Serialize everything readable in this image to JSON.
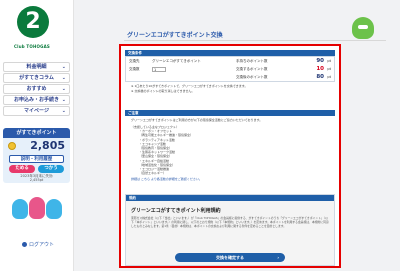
{
  "brand": {
    "number": "2",
    "name": "Club TOHOGAS"
  },
  "nav": {
    "items": [
      {
        "label": "料金明細"
      },
      {
        "label": "がすてきコラム"
      },
      {
        "label": "おすすめ"
      },
      {
        "label": "お申込み・お手続き"
      },
      {
        "label": "マイページ"
      }
    ]
  },
  "points": {
    "header": "がすてきポイント",
    "value": "2,805",
    "exchange_label": "説明・利用履歴",
    "save_label": "ためる",
    "use_label": "つかう",
    "expire_date": "2023年3月末に失効",
    "expire_points": "2,455pt"
  },
  "logout": {
    "label": "ログアウト"
  },
  "main": {
    "title": "グリーンエコがすてきポイント交換",
    "form_header": "交換条件",
    "row1": {
      "label": "交換先",
      "value": "グリーンエコがすてきポイント",
      "right_label": "手持ちのポイント数",
      "right_value": "90",
      "unit": "pt"
    },
    "row2": {
      "label": "交換数",
      "value": "1",
      "right_label": "交換するポイント数",
      "right_value": "10",
      "unit": "pt"
    },
    "row3": {
      "right_label": "交換後のポイント数",
      "right_value": "80",
      "unit": "pt"
    },
    "notes": [
      "※ 1口あたり10がすてきポイントで、グリーンエコがすてきポイントを交換できます。",
      "※ 交換後のポイントの取り消しはできません。"
    ],
    "info_header": "ご注意",
    "info_text": "グリーンエコがすてきポイントはご利用の方が以下の環境保全活動にご協力いただいております。",
    "list": [
      "〈支援している主なプロジェクト〉",
      "・カーボン・オフセット",
      "（再生可能エネルギー推進・環境保全）",
      "・ボランティアネット活動",
      "・エコキャンプ活動",
      "（環境教育・環境保全）",
      "・生態系ネットワーク活動",
      "（里山保全・環境保全）",
      "・エネルギー自給活動",
      "（地域活性化・環境保全）",
      "・エコロジー活動推進",
      "（自然エネルギー）"
    ],
    "link_note": "詳細は こちら より各活動の詳細をご確認ください。"
  },
  "modal": {
    "header": "規約",
    "title": "グリーンエコがすてきポイント利用規約",
    "body": "東邦ガス株式会社（以下「当社」といいます。）が「Club TOHOGAS」の会員様に提供する、がすてきポイントのうち「グリーンエコがすてきポイント」（以下「本ポイント」といいます。）の利用に関し、以下のとおり規約（以下「本規約」といいます。）を定めます。本ポイントを利用する会員様は、本規約に同意したものとみなします。第1条（目的）本規約は、本ポイントの交換および利用に関する条件を定めることを目的とします。",
    "confirm_label": "交換を確定する",
    "arrow": "›"
  }
}
